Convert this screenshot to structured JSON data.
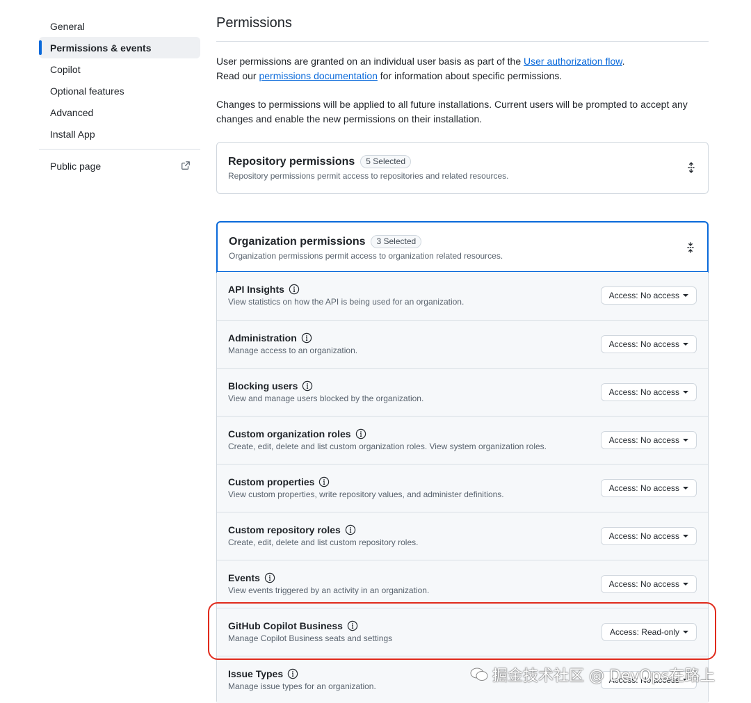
{
  "sidebar": {
    "items": [
      {
        "label": "General"
      },
      {
        "label": "Permissions & events"
      },
      {
        "label": "Copilot"
      },
      {
        "label": "Optional features"
      },
      {
        "label": "Advanced"
      },
      {
        "label": "Install App"
      }
    ],
    "public_page": "Public page"
  },
  "header": {
    "title": "Permissions"
  },
  "intro": {
    "line1_pre": "User permissions are granted on an individual user basis as part of the ",
    "line1_link": "User authorization flow",
    "line1_post": ".",
    "line2_pre": "Read our ",
    "line2_link": "permissions documentation",
    "line2_post": " for information about specific permissions.",
    "line3": "Changes to permissions will be applied to all future installations. Current users will be prompted to accept any changes and enable the new permissions on their installation."
  },
  "repo_permissions": {
    "title": "Repository permissions",
    "counter": "5 Selected",
    "desc": "Repository permissions permit access to repositories and related resources."
  },
  "org_permissions": {
    "title": "Organization permissions",
    "counter": "3 Selected",
    "desc": "Organization permissions permit access to organization related resources.",
    "rows": [
      {
        "name": "API Insights",
        "desc": "View statistics on how the API is being used for an organization.",
        "access": "Access: No access"
      },
      {
        "name": "Administration",
        "desc": "Manage access to an organization.",
        "access": "Access: No access"
      },
      {
        "name": "Blocking users",
        "desc": "View and manage users blocked by the organization.",
        "access": "Access: No access"
      },
      {
        "name": "Custom organization roles",
        "desc": "Create, edit, delete and list custom organization roles. View system organization roles.",
        "access": "Access: No access"
      },
      {
        "name": "Custom properties",
        "desc": "View custom properties, write repository values, and administer definitions.",
        "access": "Access: No access"
      },
      {
        "name": "Custom repository roles",
        "desc": "Create, edit, delete and list custom repository roles.",
        "access": "Access: No access"
      },
      {
        "name": "Events",
        "desc": "View events triggered by an activity in an organization.",
        "access": "Access: No access"
      },
      {
        "name": "GitHub Copilot Business",
        "desc": "Manage Copilot Business seats and settings",
        "access": "Access: Read-only"
      },
      {
        "name": "Issue Types",
        "desc": "Manage issue types for an organization.",
        "access": "Access: No access"
      }
    ]
  },
  "watermark": {
    "text": "掘金技术社区 @ DevOps在路上"
  },
  "colors": {
    "accent": "#0969da",
    "highlight": "#e02a1b",
    "row_bg": "#f6f8fa"
  }
}
